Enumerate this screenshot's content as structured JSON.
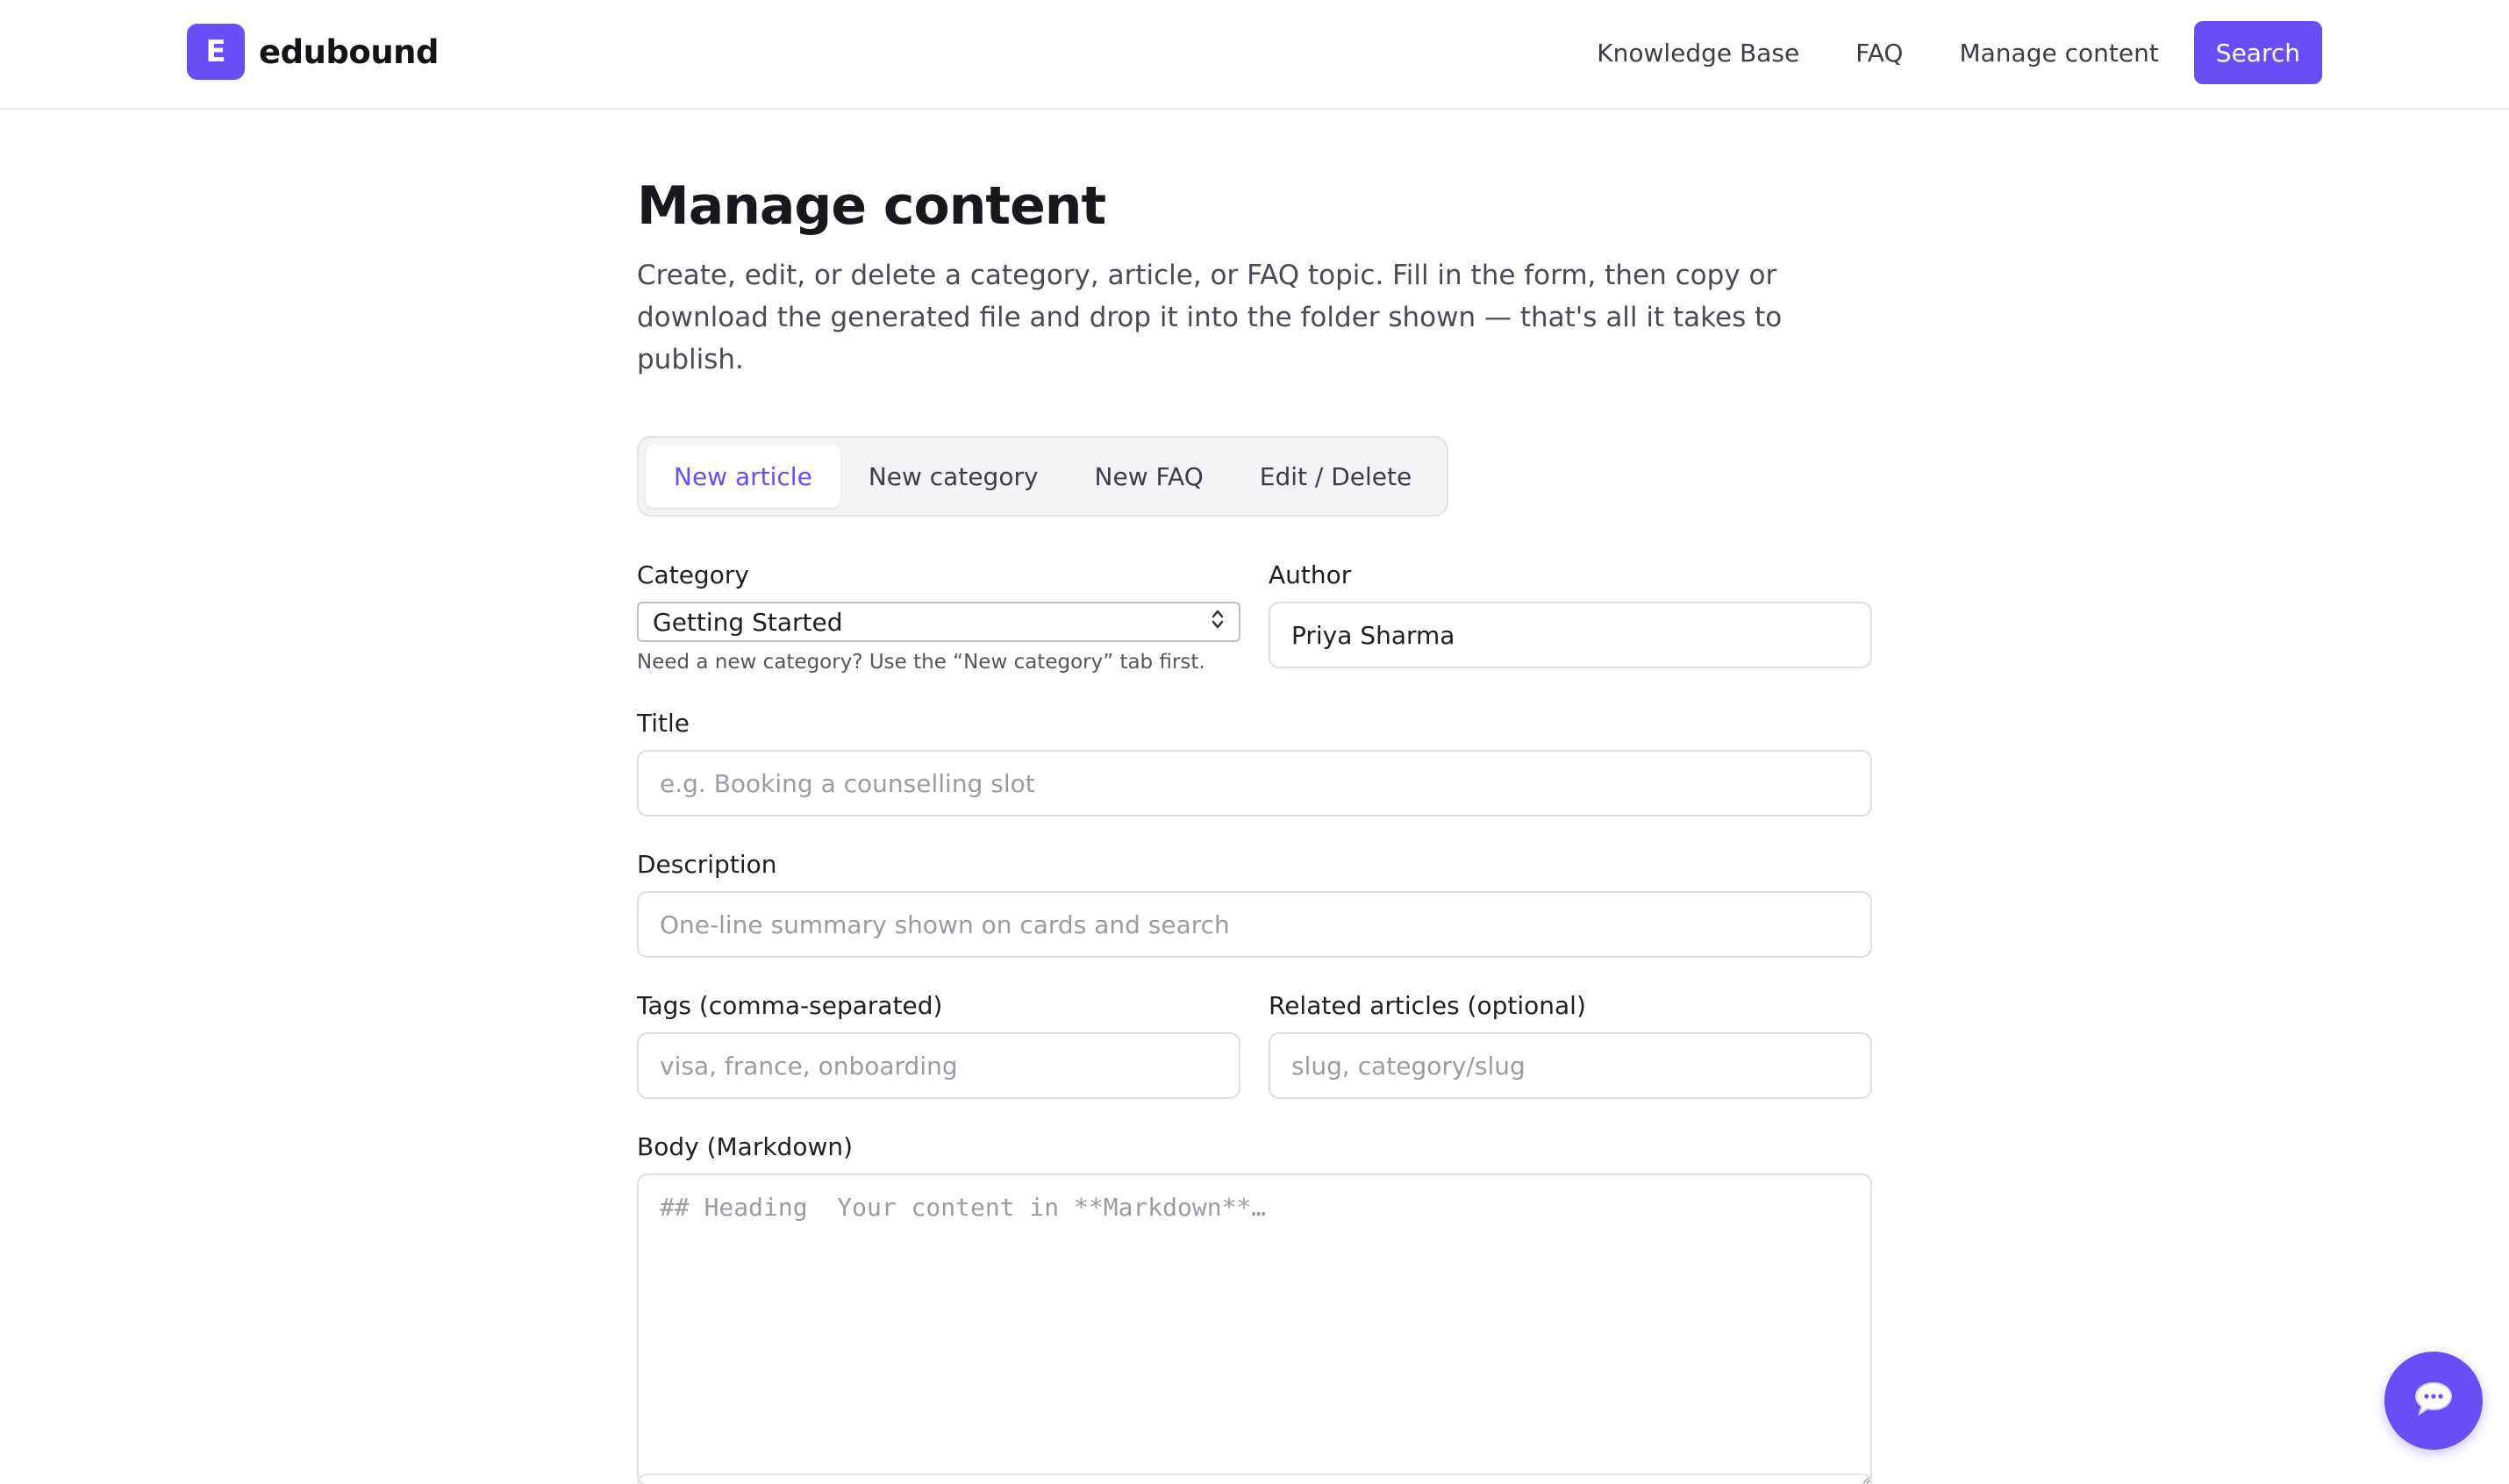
{
  "header": {
    "logo_letter": "E",
    "brand": "edubound",
    "nav": [
      "Knowledge Base",
      "FAQ",
      "Manage content"
    ],
    "search_label": "Search"
  },
  "page": {
    "title": "Manage content",
    "description": "Create, edit, or delete a category, article, or FAQ topic. Fill in the form, then copy or download the generated file and drop it into the folder shown — that's all it takes to publish."
  },
  "tabs": [
    {
      "label": "New article",
      "active": true
    },
    {
      "label": "New category",
      "active": false
    },
    {
      "label": "New FAQ",
      "active": false
    },
    {
      "label": "Edit / Delete",
      "active": false
    }
  ],
  "form": {
    "category": {
      "label": "Category",
      "value": "Getting Started",
      "hint": "Need a new category? Use the “New category” tab first."
    },
    "author": {
      "label": "Author",
      "value": "Priya Sharma"
    },
    "title": {
      "label": "Title",
      "placeholder": "e.g. Booking a counselling slot"
    },
    "description": {
      "label": "Description",
      "placeholder": "One-line summary shown on cards and search"
    },
    "tags": {
      "label": "Tags (comma-separated)",
      "placeholder": "visa, france, onboarding"
    },
    "related": {
      "label": "Related articles (optional)",
      "placeholder": "slug, category/slug"
    },
    "body": {
      "label": "Body (Markdown)",
      "placeholder": "## Heading  Your content in **Markdown**…"
    }
  },
  "colors": {
    "accent": "#6a4df4"
  },
  "icons": {
    "select": "chevron-up-down-icon",
    "chat": "chat-bubble-icon"
  }
}
